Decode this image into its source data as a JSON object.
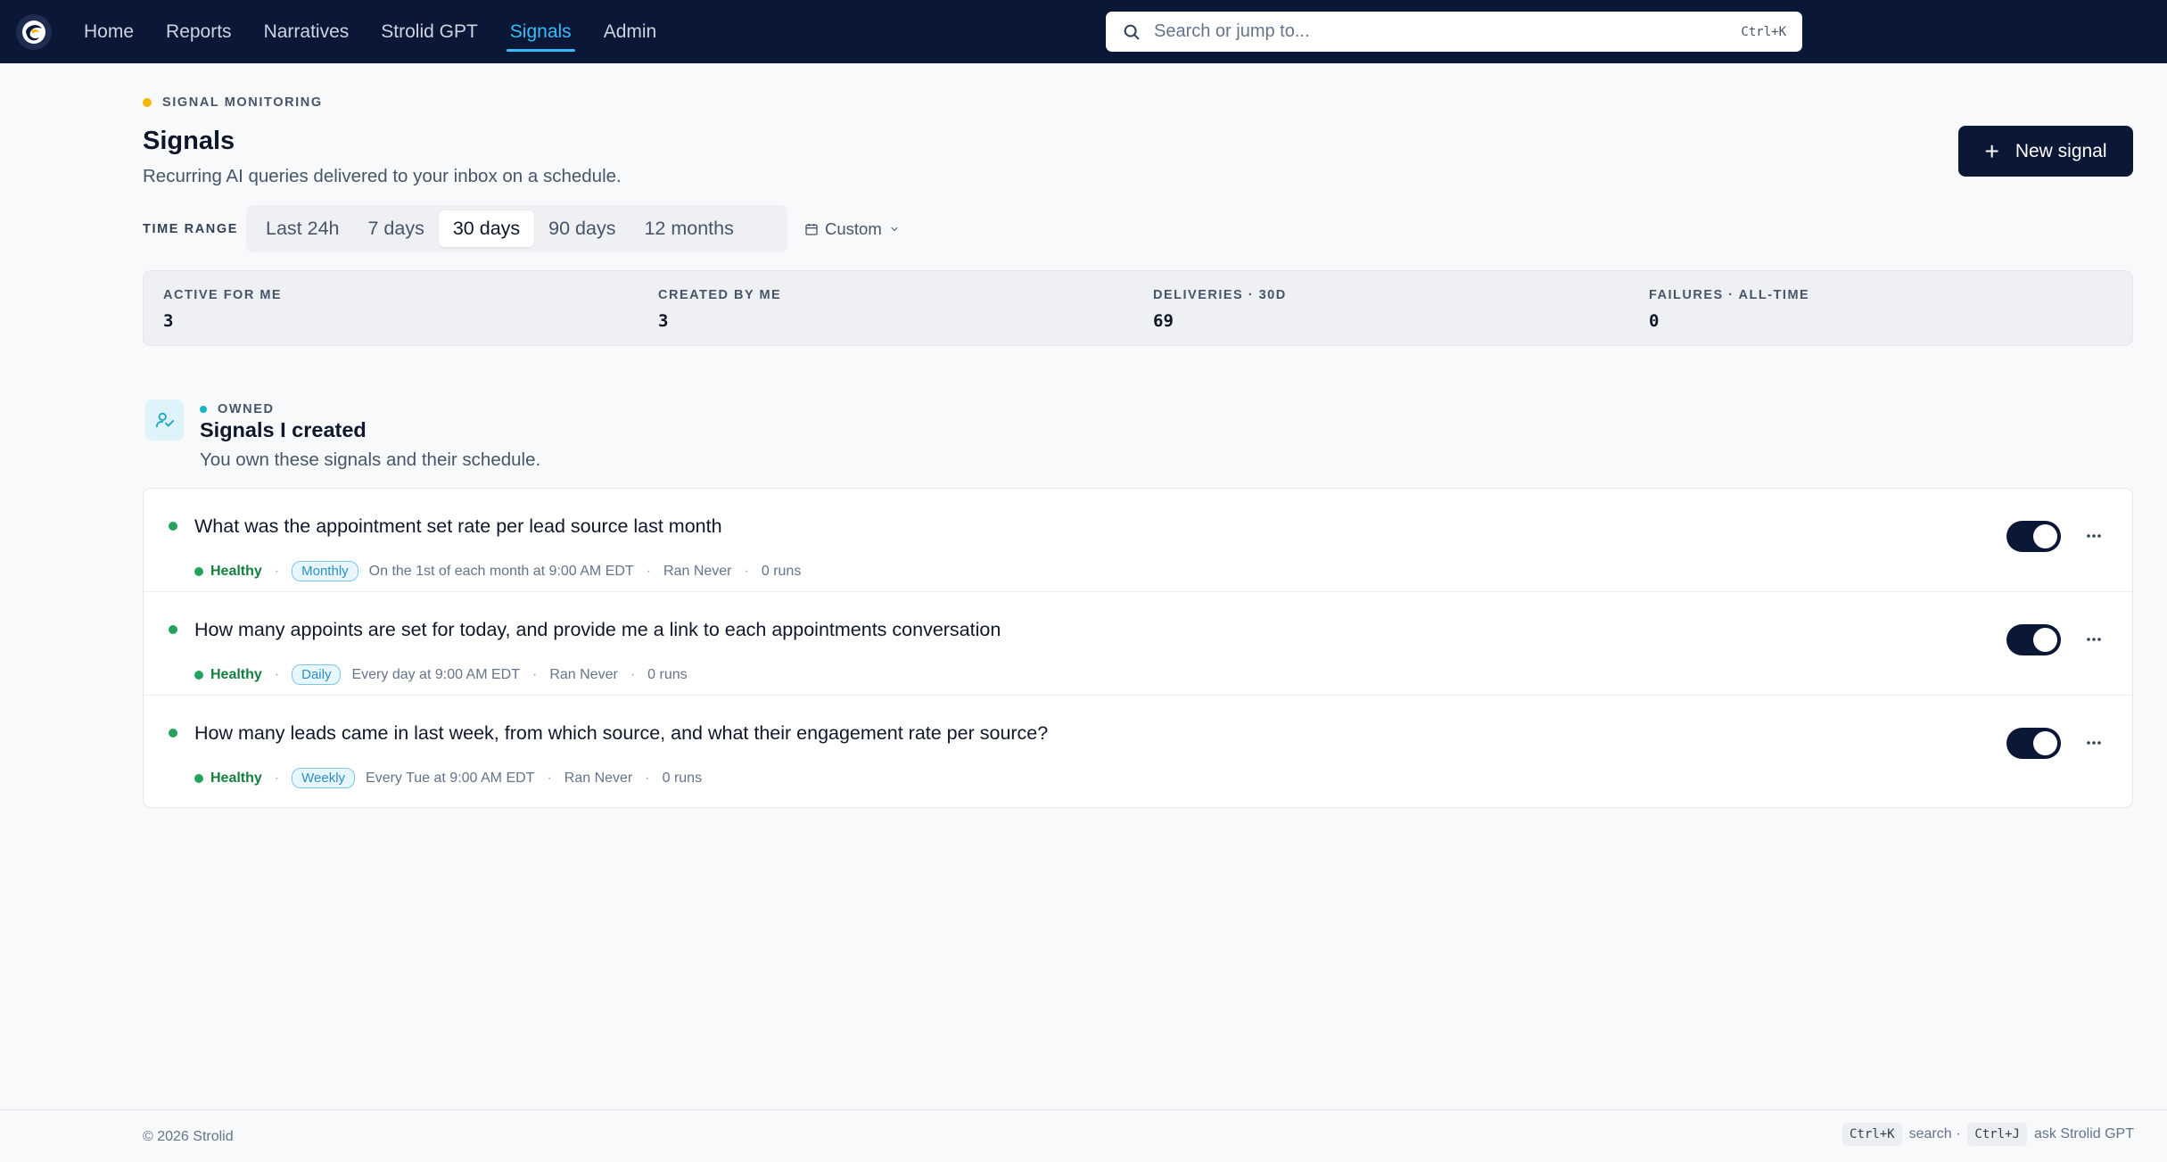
{
  "nav": {
    "items": [
      {
        "label": "Home",
        "active": false
      },
      {
        "label": "Reports",
        "active": false
      },
      {
        "label": "Narratives",
        "active": false
      },
      {
        "label": "Strolid GPT",
        "active": false
      },
      {
        "label": "Signals",
        "active": true
      },
      {
        "label": "Admin",
        "active": false
      }
    ],
    "search_placeholder": "Search or jump to...",
    "search_shortcut": "Ctrl+K"
  },
  "header": {
    "eyebrow": "SIGNAL MONITORING",
    "title": "Signals",
    "subtitle": "Recurring AI queries delivered to your inbox on a schedule.",
    "new_button": "New signal"
  },
  "time_range": {
    "label": "TIME RANGE",
    "options": [
      "Last 24h",
      "7 days",
      "30 days",
      "90 days",
      "12 months"
    ],
    "selected": "30 days",
    "custom_label": "Custom"
  },
  "stats": [
    {
      "label": "ACTIVE FOR ME",
      "value": "3"
    },
    {
      "label": "CREATED BY ME",
      "value": "3"
    },
    {
      "label": "DELIVERIES · 30D",
      "value": "69"
    },
    {
      "label": "FAILURES · ALL-TIME",
      "value": "0"
    }
  ],
  "section": {
    "eyebrow": "OWNED",
    "title": "Signals I created",
    "subtitle": "You own these signals and their schedule.",
    "signals": [
      {
        "question": "What was the appointment set rate per lead source last month",
        "health": "Healthy",
        "frequency": "Monthly",
        "schedule": "On the 1st of each month at 9:00 AM EDT",
        "last_run": "Ran Never",
        "runs": "0 runs",
        "enabled": true
      },
      {
        "question": "How many appoints are set for today, and provide me a link to each appointments conversation",
        "health": "Healthy",
        "frequency": "Daily",
        "schedule": "Every day at 9:00 AM EDT",
        "last_run": "Ran Never",
        "runs": "0 runs",
        "enabled": true
      },
      {
        "question": "How many leads came in last week, from which source, and what their engagement rate per source?",
        "health": "Healthy",
        "frequency": "Weekly",
        "schedule": "Every Tue at 9:00 AM EDT",
        "last_run": "Ran Never",
        "runs": "0 runs",
        "enabled": true
      }
    ]
  },
  "footer": {
    "copyright": "© 2026 Strolid",
    "search_key": "Ctrl+K",
    "search_label": "search ·",
    "gpt_key": "Ctrl+J",
    "gpt_label": "ask Strolid GPT"
  },
  "colors": {
    "nav_bg": "#0b1736",
    "active_nav": "#38bdf8",
    "healthy": "#22a55b",
    "eyebrow_dot": "#f5b700",
    "owned_dot": "#14b8c4"
  }
}
